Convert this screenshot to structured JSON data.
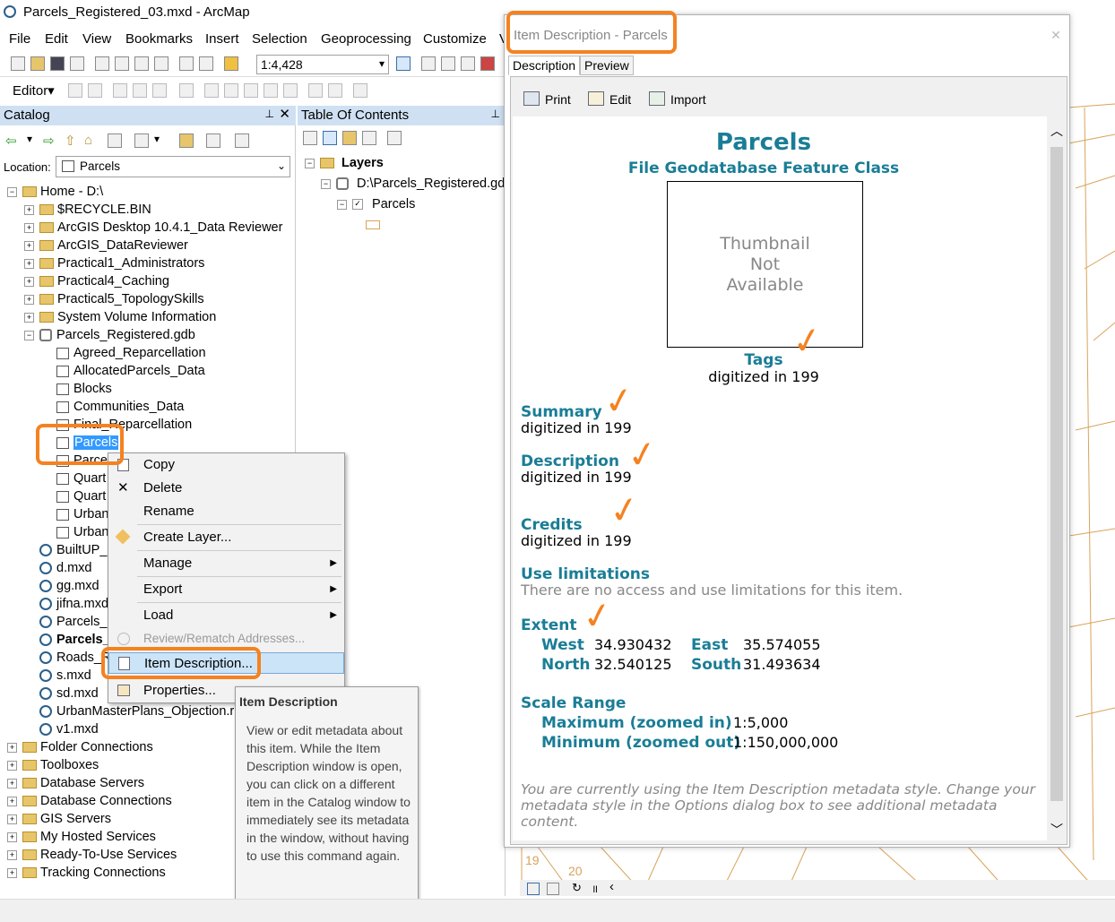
{
  "window": {
    "title": "Parcels_Registered_03.mxd - ArcMap"
  },
  "menu": [
    "File",
    "Edit",
    "View",
    "Bookmarks",
    "Insert",
    "Selection",
    "Geoprocessing",
    "Customize",
    "V"
  ],
  "toolbar": {
    "scale": "1:4,428",
    "editor_label": "Editor▾"
  },
  "catalog": {
    "title": "Catalog",
    "location_label": "Location:",
    "location_value": "Parcels",
    "items": [
      {
        "label": "Home - D:\\",
        "indent": 0,
        "exp": "−",
        "icon": "folder"
      },
      {
        "label": "$RECYCLE.BIN",
        "indent": 1,
        "exp": "+",
        "icon": "folder"
      },
      {
        "label": "ArcGIS Desktop 10.4.1_Data Reviewer",
        "indent": 1,
        "exp": "+",
        "icon": "folder"
      },
      {
        "label": "ArcGIS_DataReviewer",
        "indent": 1,
        "exp": "+",
        "icon": "folder"
      },
      {
        "label": "Practical1_Administrators",
        "indent": 1,
        "exp": "+",
        "icon": "folder"
      },
      {
        "label": "Practical4_Caching",
        "indent": 1,
        "exp": "+",
        "icon": "folder"
      },
      {
        "label": "Practical5_TopologySkills",
        "indent": 1,
        "exp": "+",
        "icon": "folder"
      },
      {
        "label": "System Volume Information",
        "indent": 1,
        "exp": "+",
        "icon": "folder"
      },
      {
        "label": "Parcels_Registered.gdb",
        "indent": 1,
        "exp": "−",
        "icon": "gdb"
      },
      {
        "label": "Agreed_Reparcellation",
        "indent": 2,
        "exp": "",
        "icon": "fc"
      },
      {
        "label": "AllocatedParcels_Data",
        "indent": 2,
        "exp": "",
        "icon": "fc"
      },
      {
        "label": "Blocks",
        "indent": 2,
        "exp": "",
        "icon": "fc"
      },
      {
        "label": "Communities_Data",
        "indent": 2,
        "exp": "",
        "icon": "fc"
      },
      {
        "label": "Final_Reparcellation",
        "indent": 2,
        "exp": "",
        "icon": "fc"
      },
      {
        "label": "Parcels",
        "indent": 2,
        "exp": "",
        "icon": "fc",
        "selected": true
      },
      {
        "label": "Parce",
        "indent": 2,
        "exp": "",
        "icon": "fc"
      },
      {
        "label": "Quart",
        "indent": 2,
        "exp": "",
        "icon": "fc"
      },
      {
        "label": "Quart",
        "indent": 2,
        "exp": "",
        "icon": "fc"
      },
      {
        "label": "Urban",
        "indent": 2,
        "exp": "",
        "icon": "fc"
      },
      {
        "label": "Urban",
        "indent": 2,
        "exp": "",
        "icon": "fc"
      },
      {
        "label": "BuiltUP_I",
        "indent": 1,
        "exp": "",
        "icon": "mxd"
      },
      {
        "label": "d.mxd",
        "indent": 1,
        "exp": "",
        "icon": "mxd"
      },
      {
        "label": "gg.mxd",
        "indent": 1,
        "exp": "",
        "icon": "mxd"
      },
      {
        "label": "jifna.mxd",
        "indent": 1,
        "exp": "",
        "icon": "mxd"
      },
      {
        "label": "Parcels_F",
        "indent": 1,
        "exp": "",
        "icon": "mxd"
      },
      {
        "label": "Parcels_",
        "indent": 1,
        "exp": "",
        "icon": "mxd",
        "bold": true
      },
      {
        "label": "Roads_R",
        "indent": 1,
        "exp": "",
        "icon": "mxd"
      },
      {
        "label": "s.mxd",
        "indent": 1,
        "exp": "",
        "icon": "mxd"
      },
      {
        "label": "sd.mxd",
        "indent": 1,
        "exp": "",
        "icon": "mxd"
      },
      {
        "label": "UrbanMasterPlans_Objection.r",
        "indent": 1,
        "exp": "",
        "icon": "mxd"
      },
      {
        "label": "v1.mxd",
        "indent": 1,
        "exp": "",
        "icon": "mxd"
      },
      {
        "label": "Folder Connections",
        "indent": 0,
        "exp": "+",
        "icon": "folder"
      },
      {
        "label": "Toolboxes",
        "indent": 0,
        "exp": "+",
        "icon": "folder"
      },
      {
        "label": "Database Servers",
        "indent": 0,
        "exp": "+",
        "icon": "folder"
      },
      {
        "label": "Database Connections",
        "indent": 0,
        "exp": "+",
        "icon": "folder"
      },
      {
        "label": "GIS Servers",
        "indent": 0,
        "exp": "+",
        "icon": "folder"
      },
      {
        "label": "My Hosted Services",
        "indent": 0,
        "exp": "+",
        "icon": "folder"
      },
      {
        "label": "Ready-To-Use Services",
        "indent": 0,
        "exp": "+",
        "icon": "folder"
      },
      {
        "label": "Tracking Connections",
        "indent": 0,
        "exp": "+",
        "icon": "folder"
      }
    ]
  },
  "toc": {
    "title": "Table Of Contents",
    "layers": "Layers",
    "gdb": "D:\\Parcels_Registered.gdl",
    "layer": "Parcels"
  },
  "context_menu": {
    "items": [
      {
        "label": "Copy",
        "icon": "copy-icon"
      },
      {
        "label": "Delete",
        "icon": "delete-icon"
      },
      {
        "label": "Rename",
        "icon": ""
      },
      {
        "label": "Create Layer...",
        "icon": "layer-icon"
      },
      {
        "label": "Manage",
        "icon": "",
        "submenu": true
      },
      {
        "label": "Export",
        "icon": "",
        "submenu": true
      },
      {
        "label": "Load",
        "icon": "",
        "submenu": true
      },
      {
        "label": "Review/Rematch Addresses...",
        "icon": "",
        "disabled": true
      },
      {
        "label": "Item Description...",
        "icon": "description-icon",
        "highlight": true
      },
      {
        "label": "Properties...",
        "icon": "properties-icon"
      }
    ]
  },
  "tooltip": {
    "title": "Item Description",
    "body": "View or edit metadata about this item. While the Item Description window is open, you can click on a different item in the Catalog window to immediately see its metadata in the window, without having to use this command again."
  },
  "item_desc": {
    "title": "Item Description - Parcels",
    "tabs": [
      "Description",
      "Preview"
    ],
    "tools": [
      "Print",
      "Edit",
      "Import"
    ],
    "name": "Parcels",
    "type": "File Geodatabase Feature Class",
    "thumbnail": [
      "Thumbnail",
      "Not",
      "Available"
    ],
    "tags_label": "Tags",
    "tags_value": "digitized in 199",
    "summary_label": "Summary",
    "summary_value": "digitized in 199",
    "description_label": "Description",
    "description_value": "digitized in 199",
    "credits_label": "Credits",
    "credits_value": "digitized in 199",
    "use_label": "Use limitations",
    "use_value": "There are no access and use limitations for this item.",
    "extent_label": "Extent",
    "west_label": "West",
    "west": "34.930432",
    "east_label": "East",
    "east": "35.574055",
    "north_label": "North",
    "north": "32.540125",
    "south_label": "South",
    "south": "31.493634",
    "scale_label": "Scale Range",
    "max_label": "Maximum (zoomed in)",
    "max": "1:5,000",
    "min_label": "Minimum (zoomed out)",
    "min": "1:150,000,000",
    "footer": "You are currently using the Item Description metadata style. Change your metadata style in the Options dialog box to see additional metadata content."
  },
  "map_labels": [
    "19",
    "20"
  ]
}
